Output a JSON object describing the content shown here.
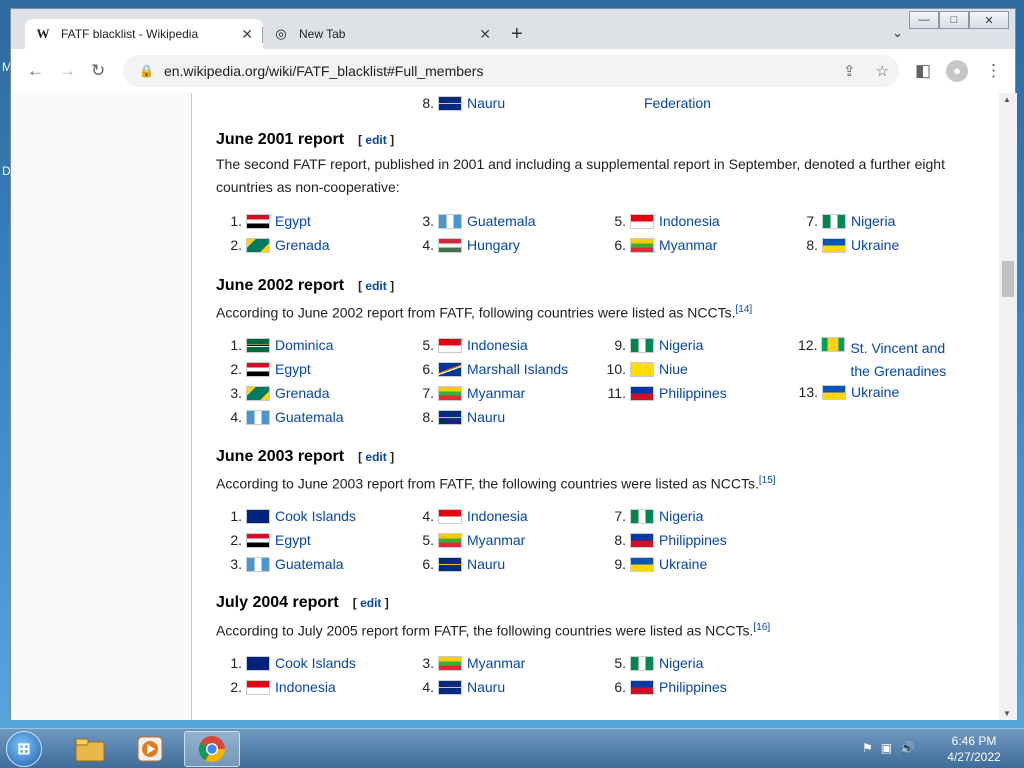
{
  "desktop": {
    "left_glyph_top": "M",
    "left_glyph_mid": "D"
  },
  "window_controls": {
    "minimize": "—",
    "maximize": "□",
    "close": "✕"
  },
  "tabs": [
    {
      "favicon": "W",
      "title": "FATF blacklist - Wikipedia",
      "close": "✕",
      "icon": "wikipedia-icon"
    },
    {
      "favicon": "◎",
      "title": "New Tab",
      "close": "✕",
      "icon": "chrome-icon"
    }
  ],
  "newtab_label": "+",
  "tab_menu": "⌄",
  "toolbar": {
    "back": "←",
    "forward": "→",
    "reload": "↻",
    "url": "en.wikipedia.org/wiki/FATF_blacklist#Full_members",
    "share": "⇪",
    "bookmark": "☆",
    "sidepanel": "◧",
    "menu": "⋮",
    "avatar": "●"
  },
  "top_remnant": {
    "item": {
      "num": "8.",
      "name": "Nauru"
    },
    "col3": "Federation"
  },
  "sections": [
    {
      "title": "June 2001 report",
      "edit": "edit",
      "para": "The second FATF report, published in 2001 and including a supplemental report in September, denoted a further eight countries as non-cooperative:",
      "sup": "",
      "columns": [
        [
          {
            "num": "1.",
            "name": "Egypt",
            "flag": "egypt"
          },
          {
            "num": "2.",
            "name": "Grenada",
            "flag": "grenada"
          }
        ],
        [
          {
            "num": "3.",
            "name": "Guatemala",
            "flag": "guatemala"
          },
          {
            "num": "4.",
            "name": "Hungary",
            "flag": "hungary"
          }
        ],
        [
          {
            "num": "5.",
            "name": "Indonesia",
            "flag": "indonesia"
          },
          {
            "num": "6.",
            "name": "Myanmar",
            "flag": "myanmar"
          }
        ],
        [
          {
            "num": "7.",
            "name": "Nigeria",
            "flag": "nigeria"
          },
          {
            "num": "8.",
            "name": "Ukraine",
            "flag": "ukraine"
          }
        ]
      ]
    },
    {
      "title": "June 2002 report",
      "edit": "edit",
      "para": "According to June 2002 report from FATF, following countries were listed as NCCTs.",
      "sup": "[14]",
      "columns": [
        [
          {
            "num": "1.",
            "name": "Dominica",
            "flag": "dominica"
          },
          {
            "num": "2.",
            "name": "Egypt",
            "flag": "egypt"
          },
          {
            "num": "3.",
            "name": "Grenada",
            "flag": "grenada"
          },
          {
            "num": "4.",
            "name": "Guatemala",
            "flag": "guatemala"
          }
        ],
        [
          {
            "num": "5.",
            "name": "Indonesia",
            "flag": "indonesia"
          },
          {
            "num": "6.",
            "name": "Marshall Islands",
            "flag": "marshall"
          },
          {
            "num": "7.",
            "name": "Myanmar",
            "flag": "myanmar"
          },
          {
            "num": "8.",
            "name": "Nauru",
            "flag": "nauru"
          }
        ],
        [
          {
            "num": "9.",
            "name": "Nigeria",
            "flag": "nigeria"
          },
          {
            "num": "10.",
            "name": "Niue",
            "flag": "niue"
          },
          {
            "num": "11.",
            "name": "Philippines",
            "flag": "philippines"
          }
        ],
        [
          {
            "num": "12.",
            "name": "St. Vincent and the Grenadines",
            "flag": "svg"
          },
          {
            "num": "13.",
            "name": "Ukraine",
            "flag": "ukraine"
          }
        ]
      ]
    },
    {
      "title": "June 2003 report",
      "edit": "edit",
      "para": "According to June 2003 report from FATF, the following countries were listed as NCCTs.",
      "sup": "[15]",
      "columns": [
        [
          {
            "num": "1.",
            "name": "Cook Islands",
            "flag": "cook"
          },
          {
            "num": "2.",
            "name": "Egypt",
            "flag": "egypt"
          },
          {
            "num": "3.",
            "name": "Guatemala",
            "flag": "guatemala"
          }
        ],
        [
          {
            "num": "4.",
            "name": "Indonesia",
            "flag": "indonesia"
          },
          {
            "num": "5.",
            "name": "Myanmar",
            "flag": "myanmar"
          },
          {
            "num": "6.",
            "name": "Nauru",
            "flag": "nauru"
          }
        ],
        [
          {
            "num": "7.",
            "name": "Nigeria",
            "flag": "nigeria"
          },
          {
            "num": "8.",
            "name": "Philippines",
            "flag": "philippines"
          },
          {
            "num": "9.",
            "name": "Ukraine",
            "flag": "ukraine"
          }
        ]
      ]
    },
    {
      "title": "July 2004 report",
      "edit": "edit",
      "para": "According to July 2005 report form FATF, the following countries were listed as NCCTs.",
      "sup": "[16]",
      "columns": [
        [
          {
            "num": "1.",
            "name": "Cook Islands",
            "flag": "cook"
          },
          {
            "num": "2.",
            "name": "Indonesia",
            "flag": "indonesia"
          }
        ],
        [
          {
            "num": "3.",
            "name": "Myanmar",
            "flag": "myanmar"
          },
          {
            "num": "4.",
            "name": "Nauru",
            "flag": "nauru"
          }
        ],
        [
          {
            "num": "5.",
            "name": "Nigeria",
            "flag": "nigeria"
          },
          {
            "num": "6.",
            "name": "Philippines",
            "flag": "philippines"
          }
        ]
      ]
    }
  ],
  "scrollbar": {
    "up": "▲",
    "down": "▼"
  },
  "taskbar": {
    "start": "⊞",
    "tray": {
      "flag": "⚑",
      "network": "▣",
      "volume": "🔊"
    },
    "time": "6:46 PM",
    "date": "4/27/2022"
  }
}
